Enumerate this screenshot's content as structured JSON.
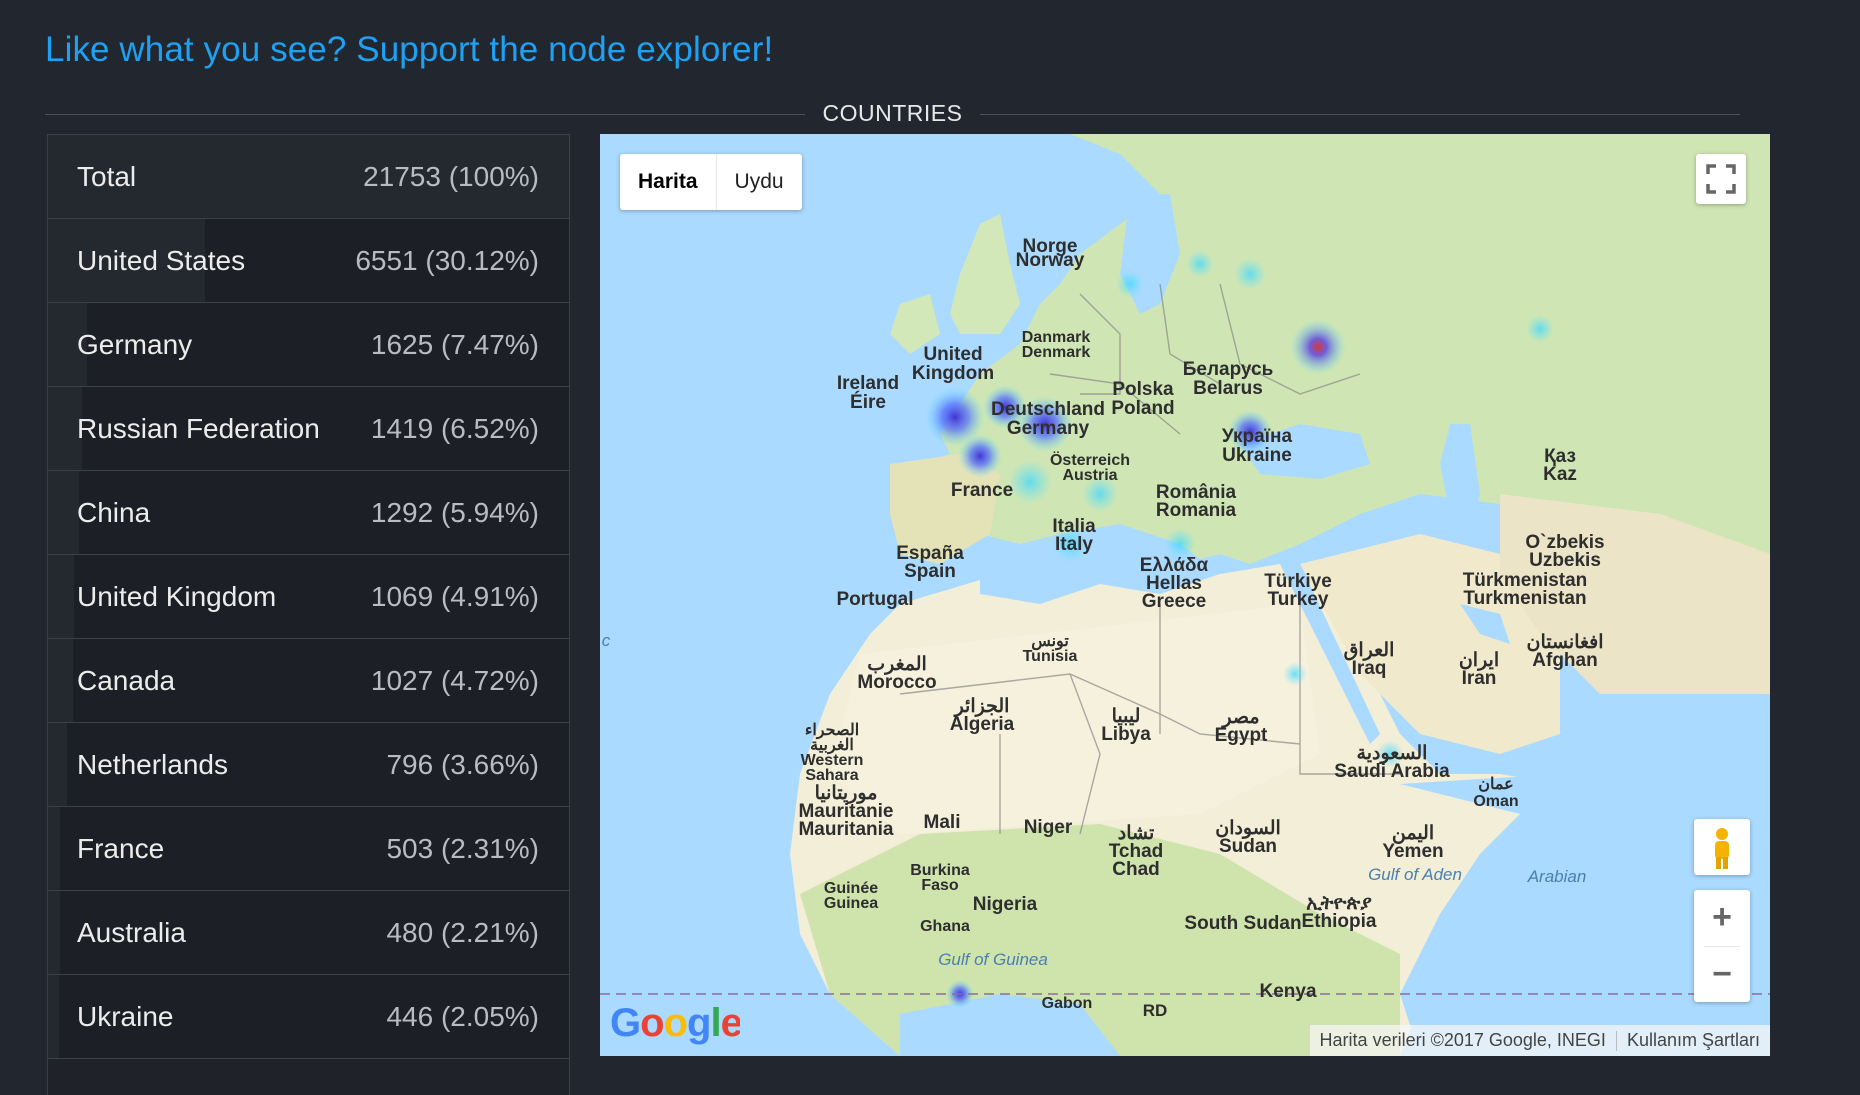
{
  "support_link": "Like what you see? Support the node explorer!",
  "section_title": "COUNTRIES",
  "countries": [
    {
      "name": "Total",
      "count": "21753 (100%)",
      "pct": 100
    },
    {
      "name": "United States",
      "count": "6551 (30.12%)",
      "pct": 30.12
    },
    {
      "name": "Germany",
      "count": "1625 (7.47%)",
      "pct": 7.47
    },
    {
      "name": "Russian Federation",
      "count": "1419 (6.52%)",
      "pct": 6.52
    },
    {
      "name": "China",
      "count": "1292 (5.94%)",
      "pct": 5.94
    },
    {
      "name": "United Kingdom",
      "count": "1069 (4.91%)",
      "pct": 4.91
    },
    {
      "name": "Canada",
      "count": "1027 (4.72%)",
      "pct": 4.72
    },
    {
      "name": "Netherlands",
      "count": "796 (3.66%)",
      "pct": 3.66
    },
    {
      "name": "France",
      "count": "503 (2.31%)",
      "pct": 2.31
    },
    {
      "name": "Australia",
      "count": "480 (2.21%)",
      "pct": 2.21
    },
    {
      "name": "Ukraine",
      "count": "446 (2.05%)",
      "pct": 2.05
    }
  ],
  "map": {
    "type_active": "Harita",
    "type_other": "Uydu",
    "attribution": "Harita verileri ©2017 Google, INEGI",
    "terms": "Kullanım Şartları",
    "logo": "Google",
    "labels": {
      "norway": "Norway",
      "norway_native": "Norge",
      "denmark_native": "Danmark",
      "denmark": "Denmark",
      "uk_1": "United",
      "uk_2": "Kingdom",
      "ireland": "Ireland",
      "ireland_native": "Éire",
      "poland_native": "Polska",
      "poland": "Poland",
      "belarus_native": "Беларусь",
      "belarus": "Belarus",
      "germany_native": "Deutschland",
      "germany": "Germany",
      "ukraine_native": "Україна",
      "ukraine": "Ukraine",
      "austria_native": "Österreich",
      "austria": "Austria",
      "france": "France",
      "romania_native": "România",
      "romania": "Romania",
      "italy_native": "Italia",
      "italy": "Italy",
      "spain_native": "España",
      "spain": "Spain",
      "greece_native": "Ελλάδα",
      "greece_1": "Hellas",
      "greece_2": "Greece",
      "turkey_native": "Türkiye",
      "turkey": "Turkey",
      "portugal": "Portugal",
      "tunisia_native": "تونس",
      "tunisia": "Tunisia",
      "morocco_native": "المغرب",
      "morocco": "Morocco",
      "algeria_native": "الجزائر",
      "algeria": "Algeria",
      "libya_native": "ليبيا",
      "libya": "Libya",
      "egypt_native": "مصر",
      "egypt": "Egypt",
      "iraq_native": "العراق",
      "iraq": "Iraq",
      "iran_native": "ایران",
      "iran": "Iran",
      "uzbek_native": "O`zbekis",
      "uzbek": "Uzbekis",
      "turkmen_native": "Türkmenistan",
      "turkmen": "Turkmenistan",
      "afghan_native": "افغانستان",
      "afghan": "Afghan",
      "kaz_1": "Қаз",
      "kaz_2": "Kaz",
      "wsahara_1": "الصحراء",
      "wsahara_2": "الغربية",
      "wsahara_3": "Western",
      "wsahara_4": "Sahara",
      "mauritania_native": "موريتانيا",
      "mauritania_1": "Mauritanie",
      "mauritania_2": "Mauritania",
      "mali": "Mali",
      "niger": "Niger",
      "chad_native": "تشاد",
      "chad_1": "Tchad",
      "chad_2": "Chad",
      "sudan_native": "السودان",
      "sudan": "Sudan",
      "saudi_native": "السعودية",
      "saudi": "Saudi Arabia",
      "oman_native": "عمان",
      "oman": "Oman",
      "yemen_native": "اليمن",
      "yemen": "Yemen",
      "guinea_1": "Guinée",
      "guinea_2": "Guinea",
      "burkina_1": "Burkina",
      "burkina_2": "Faso",
      "nigeria": "Nigeria",
      "ghana": "Ghana",
      "south_sudan": "South Sudan",
      "ethiopia_native": "ኢትዮጵያ",
      "ethiopia": "Ethiopia",
      "kenya": "Kenya",
      "gabon": "Gabon",
      "rd": "RD",
      "gulf_aden": "Gulf of Aden",
      "gulf_guinea": "Gulf of Guinea",
      "arabian": "Arabian",
      "c_edge": "c"
    }
  }
}
